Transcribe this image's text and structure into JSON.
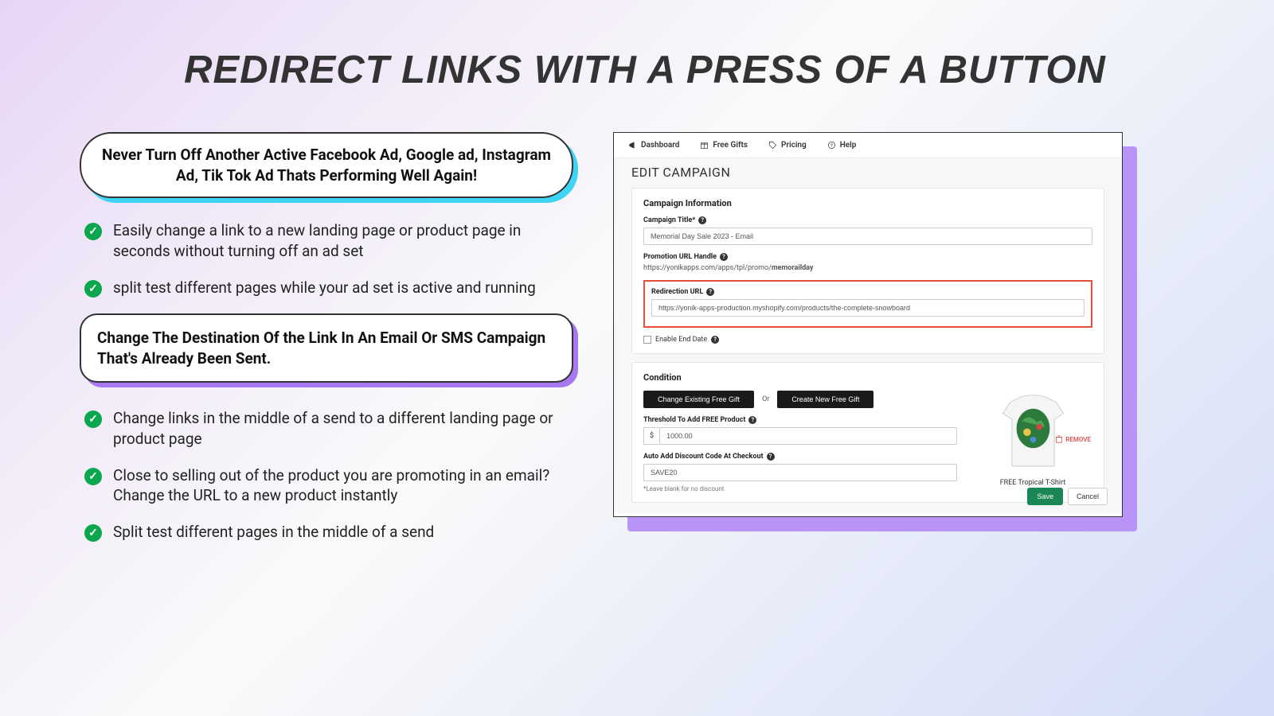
{
  "title": "REDIRECT LINKS WITH A PRESS OF A BUTTON",
  "callout1": "Never Turn Off Another Active Facebook Ad, Google ad, Instagram Ad, Tik Tok Ad Thats Performing Well Again!",
  "bullets_a": [
    "Easily change a link to a new landing page or product page in seconds without turning off an ad set",
    "split test different pages while your ad set is active and running"
  ],
  "callout2": "Change The Destination Of the Link In An Email Or SMS Campaign That's Already Been Sent.",
  "bullets_b": [
    "Change links in the middle of a send to a different landing page or product page",
    "Close to selling out of the product you are promoting in an email? Change the URL to a new product instantly",
    "Split test different pages in the middle of a send"
  ],
  "app": {
    "nav": [
      "Dashboard",
      "Free Gifts",
      "Pricing",
      "Help"
    ],
    "page_title": "EDIT CAMPAIGN",
    "section1_title": "Campaign Information",
    "campaign_title_label": "Campaign Title*",
    "campaign_title_value": "Memorial Day Sale 2023 - Email",
    "promo_label": "Promotion URL Handle",
    "promo_url_prefix": "https://yonikapps.com/apps/tpl/promo/",
    "promo_url_handle": "memorailday",
    "redirect_label": "Redirection URL",
    "redirect_value": "https://yonik-apps-production.myshopify.com/products/the-complete-snowboard",
    "enable_end_date": "Enable End Date",
    "section2_title": "Condition",
    "btn_change": "Change Existing Free Gift",
    "or": "Or",
    "btn_create": "Create New Free Gift",
    "threshold_label": "Threshold To Add FREE Product",
    "threshold_currency": "$",
    "threshold_value": "1000.00",
    "discount_label": "Auto Add Discount Code At Checkout",
    "discount_value": "SAVE20",
    "discount_hint": "*Leave blank for no discount",
    "product_name": "FREE Tropical T-Shirt",
    "remove": "REMOVE",
    "save": "Save",
    "cancel": "Cancel"
  }
}
